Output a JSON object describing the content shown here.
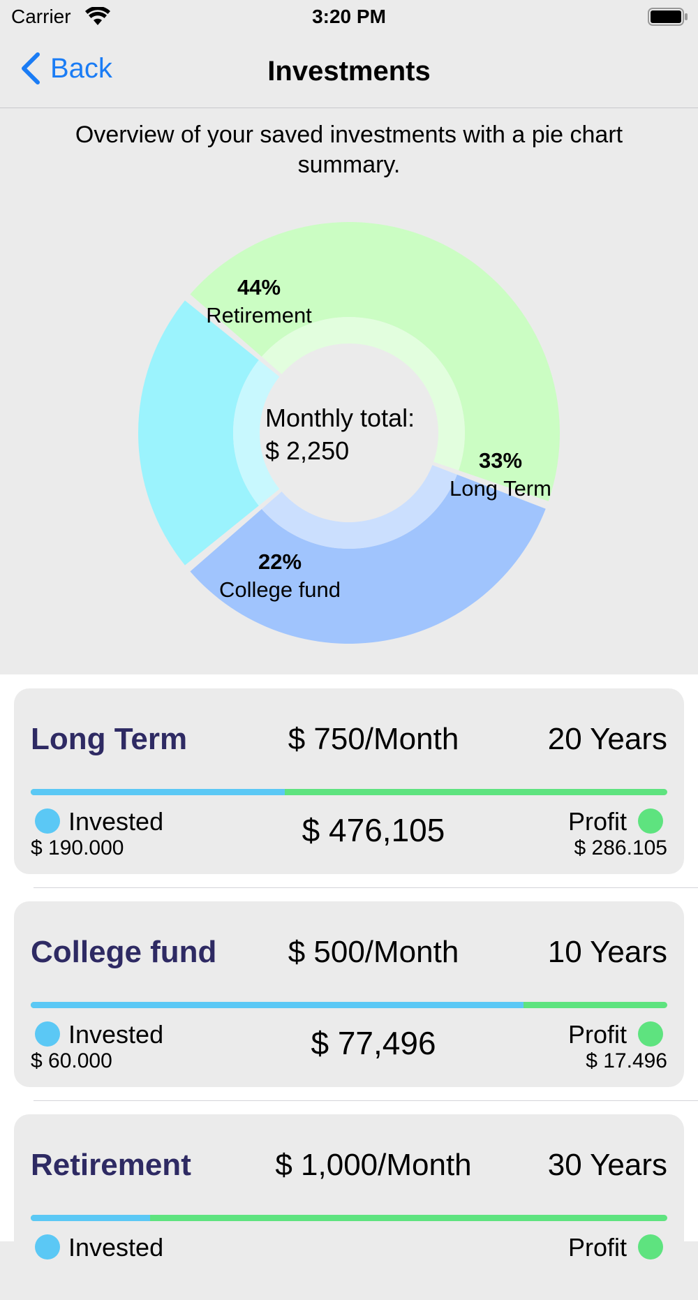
{
  "status_bar": {
    "carrier": "Carrier",
    "time": "3:20 PM"
  },
  "nav": {
    "back_label": "Back",
    "title": "Investments"
  },
  "subtitle": "Overview of your saved investments with a pie chart summary.",
  "chart_data": {
    "type": "pie",
    "center_label_1": "Monthly total:",
    "center_label_2": "$ 2,250",
    "slices": [
      {
        "name": "Retirement",
        "percent": 44,
        "label": "44%",
        "color": "#cbfdc3"
      },
      {
        "name": "Long Term",
        "percent": 33,
        "label": "33%",
        "color": "#a0c4fd"
      },
      {
        "name": "College fund",
        "percent": 22,
        "label": "22%",
        "color": "#9bf3fd"
      }
    ]
  },
  "cards": [
    {
      "name": "Long Term",
      "monthly": "$ 750/Month",
      "years": "20 Years",
      "invested_label": "Invested",
      "invested_value": "$ 190.000",
      "total": "$ 476,105",
      "profit_label": "Profit",
      "profit_value": "$ 286.105",
      "invested_fraction": 0.399
    },
    {
      "name": "College fund",
      "monthly": "$ 500/Month",
      "years": "10 Years",
      "invested_label": "Invested",
      "invested_value": "$ 60.000",
      "total": "$ 77,496",
      "profit_label": "Profit",
      "profit_value": "$ 17.496",
      "invested_fraction": 0.774
    },
    {
      "name": "Retirement",
      "monthly": "$ 1,000/Month",
      "years": "30 Years",
      "invested_label": "Invested",
      "invested_value": "",
      "total": "",
      "profit_label": "Profit",
      "profit_value": "",
      "invested_fraction": 0.187
    }
  ],
  "colors": {
    "accent": "#1a7cf5",
    "invested": "#5bc8f5",
    "profit": "#5ee37f",
    "card_title": "#2e2a63"
  }
}
